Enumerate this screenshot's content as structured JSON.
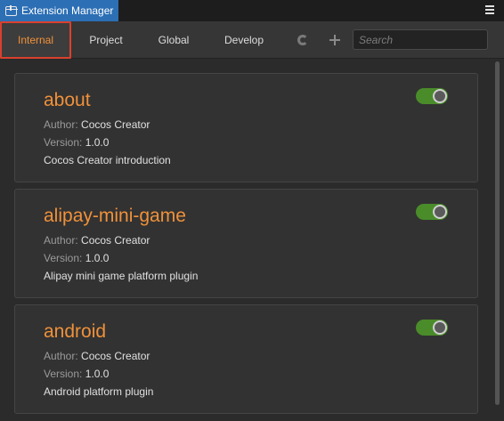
{
  "window": {
    "title": "Extension Manager",
    "icon": "package-icon",
    "menu_icon": "hamburger-menu-icon"
  },
  "tabs": [
    {
      "label": "Internal",
      "active": true
    },
    {
      "label": "Project",
      "active": false
    },
    {
      "label": "Global",
      "active": false
    },
    {
      "label": "Develop",
      "active": false
    }
  ],
  "toolbar": {
    "refresh_icon": "refresh-icon",
    "add_icon": "plus-icon",
    "search_placeholder": "Search",
    "search_value": ""
  },
  "extensions": [
    {
      "name": "about",
      "author_label": "Author:",
      "author": "Cocos Creator",
      "version_label": "Version:",
      "version": "1.0.0",
      "description": "Cocos Creator introduction",
      "enabled": true
    },
    {
      "name": "alipay-mini-game",
      "author_label": "Author:",
      "author": "Cocos Creator",
      "version_label": "Version:",
      "version": "1.0.0",
      "description": "Alipay mini game platform plugin",
      "enabled": true
    },
    {
      "name": "android",
      "author_label": "Author:",
      "author": "Cocos Creator",
      "version_label": "Version:",
      "version": "1.0.0",
      "description": "Android platform plugin",
      "enabled": true
    }
  ],
  "colors": {
    "accent": "#f0913a",
    "title_tab": "#2c6fb5",
    "toggle_on": "#4a8c2a",
    "active_tab_border": "#d9402e"
  }
}
